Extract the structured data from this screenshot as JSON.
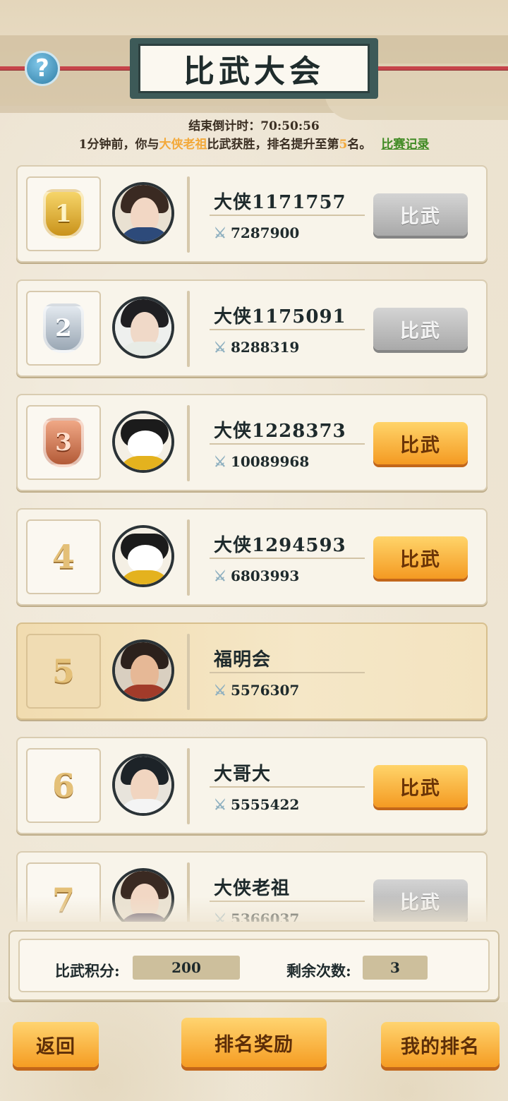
{
  "header": {
    "title": "比武大会",
    "help_icon": "?",
    "countdown": "结束倒计时：70:50:56",
    "notice_prefix": "1分钟前，你与",
    "notice_opponent": "大侠老祖",
    "notice_middle": "比武获胜，排名提升至第",
    "notice_rank": "5",
    "notice_suffix": "名。",
    "record_link": "比赛记录"
  },
  "players": [
    {
      "rank": "1",
      "name": "大侠1171757",
      "power": "7287900",
      "button": "比武",
      "button_state": "disabled"
    },
    {
      "rank": "2",
      "name": "大侠1175091",
      "power": "8288319",
      "button": "比武",
      "button_state": "disabled"
    },
    {
      "rank": "3",
      "name": "大侠1228373",
      "power": "10089968",
      "button": "比武",
      "button_state": "enabled"
    },
    {
      "rank": "4",
      "name": "大侠1294593",
      "power": "6803993",
      "button": "比武",
      "button_state": "enabled"
    },
    {
      "rank": "5",
      "name": "福明会",
      "power": "5576307",
      "button": "",
      "button_state": "self"
    },
    {
      "rank": "6",
      "name": "大哥大",
      "power": "5555422",
      "button": "比武",
      "button_state": "enabled"
    },
    {
      "rank": "7",
      "name": "大侠老祖",
      "power": "5366037",
      "button": "比武",
      "button_state": "disabled"
    }
  ],
  "stats": {
    "points_label": "比武积分:",
    "points_value": "200",
    "remaining_label": "剩余次数:",
    "remaining_value": "3"
  },
  "footer": {
    "back_label": "返回",
    "rewards_label": "排名奖励",
    "my_rank_label": "我的排名"
  },
  "colors": {
    "accent_orange": "#f59c22",
    "highlight_text": "#f3a93a",
    "link_green": "#3f8a23",
    "disabled_grey": "#a9a9a9"
  }
}
